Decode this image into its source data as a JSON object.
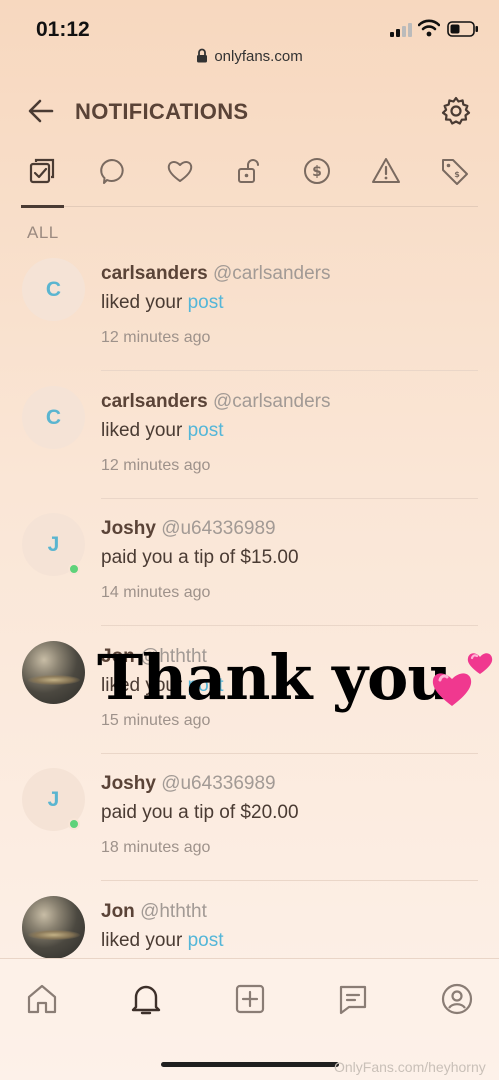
{
  "status": {
    "time": "01:12"
  },
  "browser": {
    "url": "onlyfans.com"
  },
  "header": {
    "title": "NOTIFICATIONS"
  },
  "tabs": [
    {
      "icon": "all-checkbox-icon",
      "active": true
    },
    {
      "icon": "comment-bubble-icon"
    },
    {
      "icon": "heart-icon"
    },
    {
      "icon": "unlock-icon"
    },
    {
      "icon": "dollar-circle-icon"
    },
    {
      "icon": "warning-triangle-icon"
    },
    {
      "icon": "price-tag-icon"
    }
  ],
  "section": {
    "label": "ALL"
  },
  "notifications": [
    {
      "initial": "C",
      "name": "carlsanders",
      "handle": "@carlsanders",
      "action": "liked your ",
      "link": "post",
      "time": "12 minutes ago",
      "avatar": "initial"
    },
    {
      "initial": "C",
      "name": "carlsanders",
      "handle": "@carlsanders",
      "action": "liked your ",
      "link": "post",
      "time": "12 minutes ago",
      "avatar": "initial"
    },
    {
      "initial": "J",
      "name": "Joshy",
      "handle": "@u64336989",
      "action": "paid you a tip of $15.00",
      "link": "",
      "time": "14 minutes ago",
      "avatar": "initial",
      "online": true
    },
    {
      "initial": "",
      "name": "Jon",
      "handle": "@hththt",
      "action": "liked your ",
      "link": "post",
      "time": "15 minutes ago",
      "avatar": "photo"
    },
    {
      "initial": "J",
      "name": "Joshy",
      "handle": "@u64336989",
      "action": "paid you a tip of $20.00",
      "link": "",
      "time": "18 minutes ago",
      "avatar": "initial",
      "online": true
    },
    {
      "initial": "",
      "name": "Jon",
      "handle": "@hththt",
      "action": "liked your ",
      "link": "post",
      "time": "",
      "avatar": "photo"
    }
  ],
  "overlay": {
    "text": "Thank you",
    "emoji": "two-hearts-icon"
  },
  "bottom_nav": [
    {
      "icon": "home-icon"
    },
    {
      "icon": "bell-icon",
      "active": true
    },
    {
      "icon": "add-square-icon"
    },
    {
      "icon": "messages-icon"
    },
    {
      "icon": "profile-icon"
    }
  ],
  "watermark": "OnlyFans.com/heyhorny",
  "colors": {
    "accent": "#54b6d8",
    "online": "#5ed27a",
    "text": "#4a3b33"
  }
}
